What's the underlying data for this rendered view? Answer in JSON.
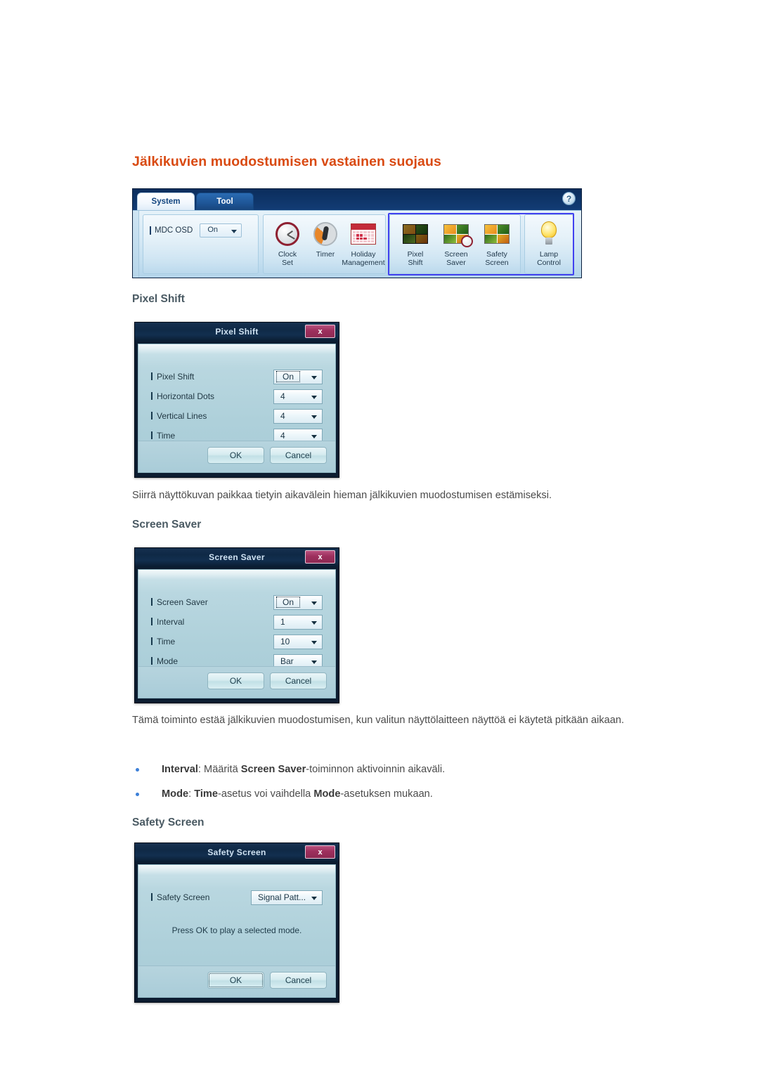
{
  "page": {
    "heading": "Jälkikuvien muodostumisen vastainen suojaus"
  },
  "ribbon": {
    "tabs": [
      {
        "label": "System",
        "active": true
      },
      {
        "label": "Tool",
        "active": false
      }
    ],
    "help_icon": "?",
    "osd": {
      "label": "MDC OSD",
      "value": "On"
    },
    "groups": {
      "time_tools": [
        {
          "name": "clock-set",
          "line1": "Clock",
          "line2": "Set"
        },
        {
          "name": "timer",
          "line1": "Timer",
          "line2": ""
        },
        {
          "name": "holiday-management",
          "line1": "Holiday",
          "line2": "Management"
        }
      ],
      "screen_tools": [
        {
          "name": "pixel-shift",
          "line1": "Pixel",
          "line2": "Shift"
        },
        {
          "name": "screen-saver",
          "line1": "Screen",
          "line2": "Saver"
        },
        {
          "name": "safety-screen",
          "line1": "Safety",
          "line2": "Screen"
        }
      ],
      "lamp_tools": [
        {
          "name": "lamp-control",
          "line1": "Lamp",
          "line2": "Control"
        }
      ]
    }
  },
  "sections": {
    "pixel_shift": {
      "heading": "Pixel Shift",
      "paragraph": "Siirrä näyttökuvan paikkaa tietyin aikavälein hieman jälkikuvien muodostumisen estämiseksi."
    },
    "screen_saver": {
      "heading": "Screen Saver",
      "paragraph": "Tämä toiminto estää jälkikuvien muodostumisen, kun valitun näyttölaitteen näyttöä ei käytetä pitkään aikaan.",
      "bullets": [
        {
          "parts": [
            {
              "text": "Interval",
              "bold": true
            },
            {
              "text": ": Määritä ",
              "bold": false
            },
            {
              "text": "Screen Saver",
              "bold": true
            },
            {
              "text": "-toiminnon aktivoinnin aikaväli.",
              "bold": false
            }
          ]
        },
        {
          "parts": [
            {
              "text": "Mode",
              "bold": true
            },
            {
              "text": ": ",
              "bold": false
            },
            {
              "text": "Time",
              "bold": true
            },
            {
              "text": "-asetus voi vaihdella ",
              "bold": false
            },
            {
              "text": "Mode",
              "bold": true
            },
            {
              "text": "-asetuksen mukaan.",
              "bold": false
            }
          ]
        }
      ]
    },
    "safety_screen": {
      "heading": "Safety Screen"
    }
  },
  "dialogs": {
    "pixel_shift": {
      "title": "Pixel Shift",
      "close_label": "x",
      "fields": [
        {
          "label": "Pixel Shift",
          "value": "On",
          "focused": true
        },
        {
          "label": "Horizontal Dots",
          "value": "4",
          "focused": false
        },
        {
          "label": "Vertical Lines",
          "value": "4",
          "focused": false
        },
        {
          "label": "Time",
          "value": "4",
          "focused": false
        }
      ],
      "ok_label": "OK",
      "cancel_label": "Cancel"
    },
    "screen_saver": {
      "title": "Screen Saver",
      "close_label": "x",
      "fields": [
        {
          "label": "Screen Saver",
          "value": "On",
          "focused": true
        },
        {
          "label": "Interval",
          "value": "1",
          "focused": false
        },
        {
          "label": "Time",
          "value": "10",
          "focused": false
        },
        {
          "label": "Mode",
          "value": "Bar",
          "focused": false
        }
      ],
      "ok_label": "OK",
      "cancel_label": "Cancel"
    },
    "safety_screen": {
      "title": "Safety Screen",
      "close_label": "x",
      "field": {
        "label": "Safety Screen",
        "value": "Signal Patt..."
      },
      "note": "Press OK to play a selected mode.",
      "ok_label": "OK",
      "cancel_label": "Cancel"
    }
  },
  "colors": {
    "heading": "#d94a12",
    "subheading": "#4a5a63",
    "bullet": "#3d80d8",
    "selection_outline": "#4141f0",
    "close_button": "#9d2f5d"
  }
}
